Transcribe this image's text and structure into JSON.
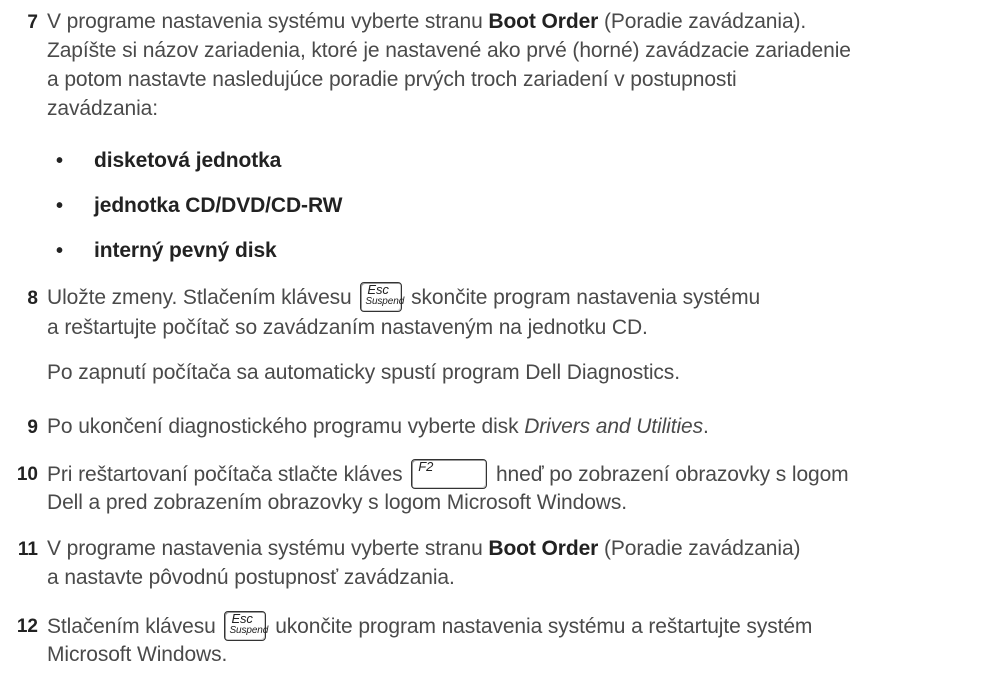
{
  "steps": {
    "s7": {
      "num": "7",
      "l1a": "V programe nastavenia systému vyberte stranu ",
      "l1b": "Boot Order",
      "l1c": " (Poradie zavádzania).",
      "l2": "Zapíšte si názov zariadenia, ktoré je nastavené ako prvé (horné) zavádzacie zariadenie",
      "l3": "a potom nastavte nasledujúce poradie prvých troch zariadení v postupnosti",
      "l4": "zavádzania:",
      "bullets": [
        "disketová jednotka",
        "jednotka CD/DVD/CD-RW",
        "interný pevný disk"
      ]
    },
    "s8": {
      "num": "8",
      "l1a": "Uložte zmeny. Stlačením klávesu ",
      "l1b": " skončite program nastavenia systému",
      "l2": "a reštartujte počítač so zavádzaním nastaveným na jednotku CD.",
      "note": "Po zapnutí počítača sa automaticky spustí program Dell Diagnostics."
    },
    "s9": {
      "num": "9",
      "l1a": "Po ukončení diagnostického programu vyberte disk ",
      "l1b": "Drivers and Utilities",
      "l1c": "."
    },
    "s10": {
      "num": "10",
      "l1a": "Pri reštartovaní počítača stlačte kláves ",
      "l1b": " hneď po zobrazení obrazovky s logom",
      "l2": "Dell a pred zobrazením obrazovky s logom Microsoft Windows."
    },
    "s11": {
      "num": "11",
      "l1a": "V programe nastavenia systému vyberte stranu ",
      "l1b": "Boot Order",
      "l1c": " (Poradie zavádzania)",
      "l2": "a nastavte pôvodnú postupnosť zavádzania."
    },
    "s12": {
      "num": "12",
      "l1a": "Stlačením klávesu ",
      "l1b": " ukončite program nastavenia systému a reštartujte systém",
      "l2": "Microsoft Windows."
    }
  },
  "keys": {
    "esc_top": "Esc",
    "esc_bottom": "Suspend",
    "f2": "F2"
  }
}
